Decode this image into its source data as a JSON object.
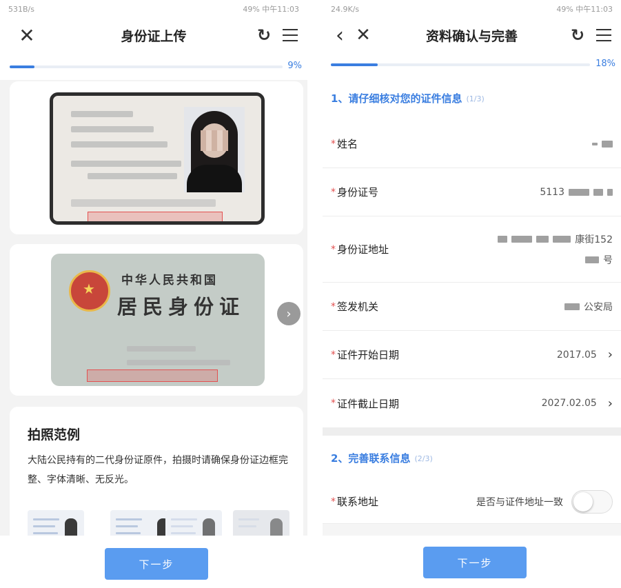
{
  "left": {
    "status": {
      "left": "531B/s",
      "right": "49% 中午11:03"
    },
    "title": "身份证上传",
    "progress": {
      "percent": 9,
      "label": "9%"
    },
    "example": {
      "title": "拍照范例",
      "desc": "大陆公民持有的二代身份证原件，拍摄时请确保身份证边框完整、字体清晰、无反光。"
    },
    "back_card": {
      "title_line1": "中华人民共和国",
      "title_line2": "居民身份证"
    },
    "next_label": "下一步"
  },
  "right": {
    "status": {
      "left": "24.9K/s",
      "right": "49% 中午11:03"
    },
    "title": "资料确认与完善",
    "progress": {
      "percent": 18,
      "label": "18%"
    },
    "section1": {
      "title": "1、请仔细核对您的证件信息",
      "step": "(1/3)"
    },
    "fields": {
      "name": {
        "label": "姓名",
        "value": ""
      },
      "id_number": {
        "label": "身份证号",
        "value": "5113"
      },
      "address": {
        "label": "身份证地址",
        "value_line1": "康街152",
        "value_line2": "号"
      },
      "issuer": {
        "label": "签发机关",
        "value": "公安局"
      },
      "start_date": {
        "label": "证件开始日期",
        "value": "2017.05"
      },
      "end_date": {
        "label": "证件截止日期",
        "value": "2027.02.05"
      }
    },
    "section2": {
      "title": "2、完善联系信息",
      "step": "(2/3)"
    },
    "contact": {
      "label": "联系地址",
      "consistent_label": "是否与证件地址一致"
    },
    "next_label": "下一步"
  },
  "colors": {
    "accent": "#3a7ee0",
    "button": "#5a9cf0",
    "required": "#e25050"
  },
  "icons": [
    "close-icon",
    "back-icon",
    "refresh-icon",
    "menu-icon",
    "chevron-right-icon"
  ]
}
